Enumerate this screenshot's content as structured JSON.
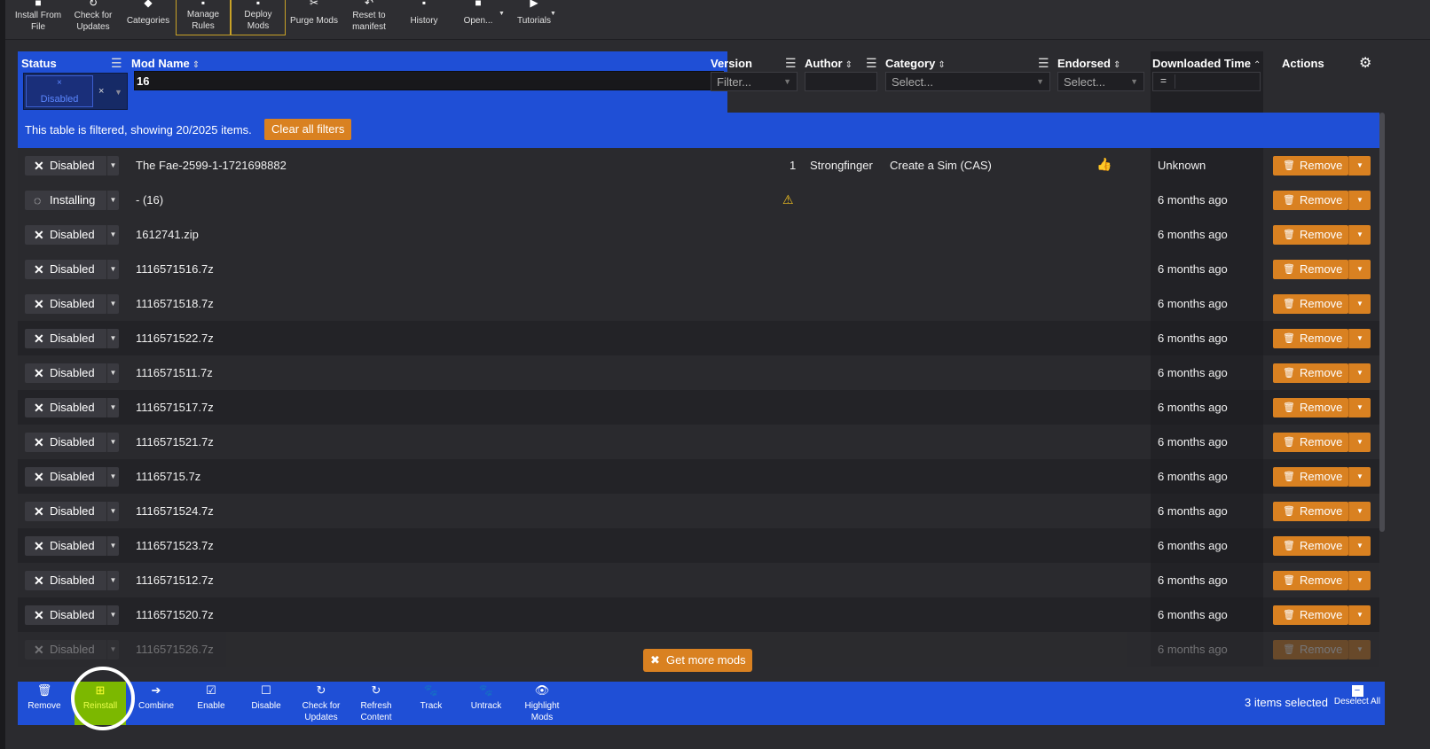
{
  "toolbar": {
    "items": [
      {
        "label": "Install From File",
        "icon": "install-icon"
      },
      {
        "label": "Check for Updates",
        "icon": "refresh-icon"
      },
      {
        "label": "Categories",
        "icon": "tag-icon"
      },
      {
        "label": "Manage Rules",
        "icon": "rules-icon"
      },
      {
        "label": "Deploy Mods",
        "icon": "deploy-icon"
      },
      {
        "label": "Purge Mods",
        "icon": "purge-icon"
      },
      {
        "label": "Reset to manifest",
        "icon": "reset-icon"
      },
      {
        "label": "History",
        "icon": "history-icon"
      },
      {
        "label": "Open...",
        "icon": "folder-icon"
      },
      {
        "label": "Tutorials",
        "icon": "video-icon"
      }
    ]
  },
  "columns": {
    "status": "Status",
    "mod_name": "Mod Name",
    "version": "Version",
    "author": "Author",
    "category": "Category",
    "endorsed": "Endorsed",
    "downloaded_time": "Downloaded Time",
    "actions": "Actions"
  },
  "filters": {
    "status_chip": "Disabled",
    "mod_name_value": "16",
    "version_placeholder": "Filter...",
    "category_placeholder": "Select...",
    "endorsed_placeholder": "Select...",
    "downloaded_op": "="
  },
  "banner": {
    "text": "This table is filtered, showing 20/2025 items.",
    "clear_label": "Clear all filters"
  },
  "rows": [
    {
      "status": "Disabled",
      "name": "The Fae-2599-1-1721698882",
      "version": "1",
      "author": "Strongfinger",
      "category": "Create a Sim (CAS)",
      "endorsed": "thumbs-up",
      "downloaded": "Unknown",
      "action": "Remove"
    },
    {
      "status": "Installing",
      "name": "- (16)",
      "version": "warning",
      "author": "",
      "category": "",
      "endorsed": "",
      "downloaded": "6 months ago",
      "action": "Remove"
    },
    {
      "status": "Disabled",
      "name": "1612741.zip",
      "version": "",
      "author": "",
      "category": "",
      "endorsed": "",
      "downloaded": "6 months ago",
      "action": "Remove"
    },
    {
      "status": "Disabled",
      "name": "1116571516.7z",
      "version": "",
      "author": "",
      "category": "",
      "endorsed": "",
      "downloaded": "6 months ago",
      "action": "Remove"
    },
    {
      "status": "Disabled",
      "name": "1116571518.7z",
      "version": "",
      "author": "",
      "category": "",
      "endorsed": "",
      "downloaded": "6 months ago",
      "action": "Remove"
    },
    {
      "status": "Disabled",
      "name": "1116571522.7z",
      "version": "",
      "author": "",
      "category": "",
      "endorsed": "",
      "downloaded": "6 months ago",
      "action": "Remove"
    },
    {
      "status": "Disabled",
      "name": "1116571511.7z",
      "version": "",
      "author": "",
      "category": "",
      "endorsed": "",
      "downloaded": "6 months ago",
      "action": "Remove"
    },
    {
      "status": "Disabled",
      "name": "1116571517.7z",
      "version": "",
      "author": "",
      "category": "",
      "endorsed": "",
      "downloaded": "6 months ago",
      "action": "Remove"
    },
    {
      "status": "Disabled",
      "name": "1116571521.7z",
      "version": "",
      "author": "",
      "category": "",
      "endorsed": "",
      "downloaded": "6 months ago",
      "action": "Remove"
    },
    {
      "status": "Disabled",
      "name": "11165715.7z",
      "version": "",
      "author": "",
      "category": "",
      "endorsed": "",
      "downloaded": "6 months ago",
      "action": "Remove"
    },
    {
      "status": "Disabled",
      "name": "1116571524.7z",
      "version": "",
      "author": "",
      "category": "",
      "endorsed": "",
      "downloaded": "6 months ago",
      "action": "Remove"
    },
    {
      "status": "Disabled",
      "name": "1116571523.7z",
      "version": "",
      "author": "",
      "category": "",
      "endorsed": "",
      "downloaded": "6 months ago",
      "action": "Remove"
    },
    {
      "status": "Disabled",
      "name": "1116571512.7z",
      "version": "",
      "author": "",
      "category": "",
      "endorsed": "",
      "downloaded": "6 months ago",
      "action": "Remove"
    },
    {
      "status": "Disabled",
      "name": "1116571520.7z",
      "version": "",
      "author": "",
      "category": "",
      "endorsed": "",
      "downloaded": "6 months ago",
      "action": "Remove"
    },
    {
      "status": "Disabled",
      "name": "1116571526.7z",
      "version": "",
      "author": "",
      "category": "",
      "endorsed": "",
      "downloaded": "6 months ago",
      "action": "Remove",
      "faded": true
    }
  ],
  "get_more_label": "Get more mods",
  "actionbar": {
    "items": [
      {
        "label": "Remove",
        "icon": "trash-icon"
      },
      {
        "label": "Reinstall",
        "icon": "plus-icon"
      },
      {
        "label": "Combine",
        "icon": "combine-icon"
      },
      {
        "label": "Enable",
        "icon": "checkbox-checked-icon"
      },
      {
        "label": "Disable",
        "icon": "checkbox-empty-icon"
      },
      {
        "label": "Check for Updates",
        "icon": "refresh-icon"
      },
      {
        "label": "Refresh Content",
        "icon": "refresh-icon"
      },
      {
        "label": "Track",
        "icon": "paw-icon"
      },
      {
        "label": "Untrack",
        "icon": "paw-off-icon"
      },
      {
        "label": "Highlight Mods",
        "icon": "eye-icon"
      }
    ],
    "selected_text": "3 items selected",
    "deselect_label": "Deselect All"
  },
  "colors": {
    "accent_blue": "#1f4fd6",
    "orange": "#d98121",
    "highlight_green": "#7cb800"
  }
}
